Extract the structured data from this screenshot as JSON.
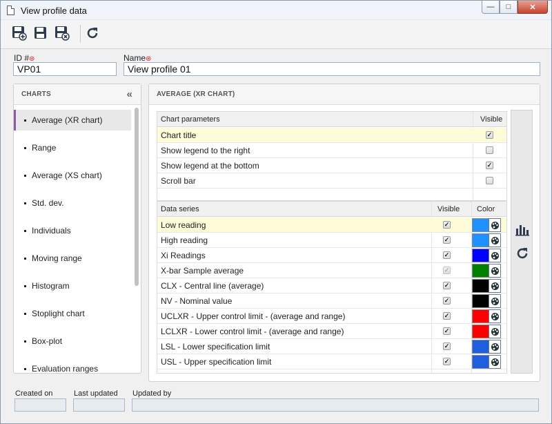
{
  "window": {
    "title": "View profile data",
    "minimize": "—",
    "maximize": "□",
    "close": "✕"
  },
  "toolbar": {
    "buttons": [
      {
        "name": "save-and-new-icon"
      },
      {
        "name": "save-icon"
      },
      {
        "name": "save-and-close-icon"
      },
      {
        "name": "refresh-icon"
      }
    ]
  },
  "fields": {
    "id_label": "ID #",
    "id_value": "VP01",
    "name_label": "Name",
    "name_value": "View profile 01"
  },
  "charts_panel": {
    "title": "CHARTS",
    "collapse": "«",
    "items": [
      "Average (XR chart)",
      "Range",
      "Average (XS chart)",
      "Std. dev.",
      "Individuals",
      "Moving range",
      "Histogram",
      "Stoplight chart",
      "Box-plot",
      "Evaluation ranges"
    ]
  },
  "main_panel": {
    "title": "AVERAGE (XR CHART)",
    "chart_params": {
      "header": "Chart parameters",
      "visible_header": "Visible",
      "rows": [
        {
          "label": "Chart title",
          "checked": "✓"
        },
        {
          "label": "Show legend to the right",
          "checked": ""
        },
        {
          "label": "Show legend at the bottom",
          "checked": "✓"
        },
        {
          "label": "Scroll bar",
          "checked": ""
        }
      ]
    },
    "data_series": {
      "header": "Data series",
      "visible_header": "Visible",
      "color_header": "Color",
      "rows": [
        {
          "label": "Low reading",
          "checked": "✓",
          "color": "#1e90ff"
        },
        {
          "label": "High reading",
          "checked": "✓",
          "color": "#1e90ff"
        },
        {
          "label": "Xi Readings",
          "checked": "✓",
          "color": "#0000ff"
        },
        {
          "label": "X-bar Sample average",
          "checked": "✓",
          "color": "#008000"
        },
        {
          "label": "CLX - Central line (average)",
          "checked": "✓",
          "color": "#000000"
        },
        {
          "label": "NV - Nominal value",
          "checked": "✓",
          "color": "#000000"
        },
        {
          "label": "UCLXR - Upper control limit - (average and range)",
          "checked": "✓",
          "color": "#ff0000"
        },
        {
          "label": "LCLXR - Lower control limit - (average and range)",
          "checked": "✓",
          "color": "#ff0000"
        },
        {
          "label": "LSL - Lower specification limit",
          "checked": "✓",
          "color": "#1e5fe0"
        },
        {
          "label": "USL - Upper specification limit",
          "checked": "✓",
          "color": "#1e5fe0"
        }
      ]
    }
  },
  "footer": {
    "created_on": "Created on",
    "last_updated": "Last updated",
    "updated_by": "Updated by"
  }
}
